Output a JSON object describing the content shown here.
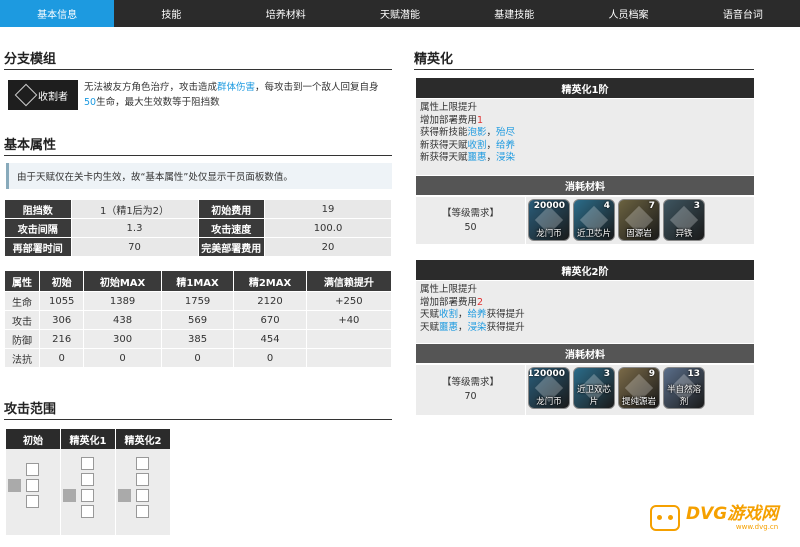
{
  "tabs": [
    {
      "label": "基本信息",
      "active": true
    },
    {
      "label": "技能",
      "active": false
    },
    {
      "label": "培养材料",
      "active": false
    },
    {
      "label": "天赋潜能",
      "active": false
    },
    {
      "label": "基建技能",
      "active": false
    },
    {
      "label": "人员档案",
      "active": false
    },
    {
      "label": "语音台词",
      "active": false
    }
  ],
  "branch": {
    "title": "分支模组",
    "name": "收割者",
    "desc_parts": [
      "无法被友方角色治疗，攻击造成",
      "群体伤害",
      "，每攻击到一个敌人回复自身",
      "50",
      "生命，最大生效数等于阻挡数"
    ]
  },
  "basic": {
    "title": "基本属性",
    "note": "由于天赋仅在关卡内生效，故“基本属性”处仅显示干员面板数值。",
    "table1": [
      [
        "阻挡数",
        "1（精1后为2）",
        "初始费用",
        "19"
      ],
      [
        "攻击间隔",
        "1.3",
        "攻击速度",
        "100.0"
      ],
      [
        "再部署时间",
        "70",
        "完美部署费用",
        "20"
      ]
    ],
    "table2_headers": [
      "属性",
      "初始",
      "初始MAX",
      "精1MAX",
      "精2MAX",
      "满信赖提升"
    ],
    "table2_rows": [
      [
        "生命",
        "1055",
        "1389",
        "1759",
        "2120",
        "+250"
      ],
      [
        "攻击",
        "306",
        "438",
        "569",
        "670",
        "+40"
      ],
      [
        "防御",
        "216",
        "300",
        "385",
        "454",
        ""
      ],
      [
        "法抗",
        "0",
        "0",
        "0",
        "0",
        ""
      ]
    ]
  },
  "range": {
    "title": "攻击范围",
    "headers": [
      "初始",
      "精英化1",
      "精英化2"
    ]
  },
  "elite": {
    "title": "精英化",
    "stage1": {
      "title": "精英化1阶",
      "lines": [
        {
          "parts": [
            {
              "t": "属性上限提升",
              "c": ""
            }
          ]
        },
        {
          "parts": [
            {
              "t": "增加部署费用",
              "c": ""
            },
            {
              "t": "1",
              "c": "red"
            }
          ]
        },
        {
          "parts": [
            {
              "t": "获得新技能",
              "c": ""
            },
            {
              "t": "泡影",
              "c": "blue"
            },
            {
              "t": "，",
              "c": ""
            },
            {
              "t": "殆尽",
              "c": "blue"
            }
          ]
        },
        {
          "parts": [
            {
              "t": "新获得天赋",
              "c": ""
            },
            {
              "t": "收割",
              "c": "blue"
            },
            {
              "t": "，",
              "c": ""
            },
            {
              "t": "给养",
              "c": "blue"
            }
          ]
        },
        {
          "parts": [
            {
              "t": "新获得天赋",
              "c": ""
            },
            {
              "t": "噩惠",
              "c": "blue"
            },
            {
              "t": "，",
              "c": ""
            },
            {
              "t": "浸染",
              "c": "blue"
            }
          ]
        }
      ],
      "mat_title": "消耗材料",
      "req_label": "【等级需求】",
      "req_value": "50",
      "materials": [
        {
          "name": "龙门币",
          "count": "20000",
          "color": "#2a5d7a"
        },
        {
          "name": "近卫芯片",
          "count": "4",
          "color": "#2b6c8a"
        },
        {
          "name": "固源岩",
          "count": "7",
          "color": "#6b6240"
        },
        {
          "name": "异铁",
          "count": "3",
          "color": "#3e5560"
        }
      ]
    },
    "stage2": {
      "title": "精英化2阶",
      "lines": [
        {
          "parts": [
            {
              "t": "属性上限提升",
              "c": ""
            }
          ]
        },
        {
          "parts": [
            {
              "t": "增加部署费用",
              "c": ""
            },
            {
              "t": "2",
              "c": "red"
            }
          ]
        },
        {
          "parts": [
            {
              "t": "天赋",
              "c": ""
            },
            {
              "t": "收割",
              "c": "blue"
            },
            {
              "t": "，",
              "c": ""
            },
            {
              "t": "给养",
              "c": "blue"
            },
            {
              "t": "获得提升",
              "c": ""
            }
          ]
        },
        {
          "parts": [
            {
              "t": "天赋",
              "c": ""
            },
            {
              "t": "噩惠",
              "c": "blue"
            },
            {
              "t": "，",
              "c": ""
            },
            {
              "t": "浸染",
              "c": "blue"
            },
            {
              "t": "获得提升",
              "c": ""
            }
          ]
        }
      ],
      "mat_title": "消耗材料",
      "req_label": "【等级需求】",
      "req_value": "70",
      "materials": [
        {
          "name": "龙门币",
          "count": "120000",
          "color": "#2a5d7a"
        },
        {
          "name": "近卫双芯片",
          "count": "3",
          "color": "#2b6c8a"
        },
        {
          "name": "提纯源岩",
          "count": "9",
          "color": "#7a6a48"
        },
        {
          "name": "半自然溶剂",
          "count": "13",
          "color": "#5a6e8a"
        }
      ]
    }
  },
  "watermark": {
    "text": "DVG游戏网",
    "sub": "www.dvg.cn"
  }
}
